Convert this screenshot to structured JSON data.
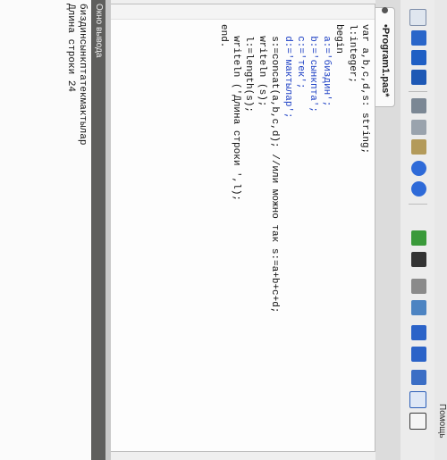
{
  "menu": {
    "help_label": "Помощь"
  },
  "tab": {
    "label": "•Program1.pas*"
  },
  "code_lines": [
    "var a,b,c,d,s: string;",
    "l:integer;",
    "begin",
    "  a:='биздин';",
    "  b:='сынкпта';",
    "  c:='тек';",
    "  d:='мактылар';",
    "  s:=concat(a,b,c,d); //или можно так s:=a+b+c+d;",
    "  writeln (s);",
    "  l:=length(s);",
    "  writeln ('Длина строки ',l);",
    "end."
  ],
  "output_panel": {
    "title": "Окно вывода",
    "lines": [
      "биздинсынкптатекмактылар",
      "Длина строки 24"
    ]
  },
  "toolbar_icons": [
    "new-file-icon",
    "open-icon",
    "save-icon",
    "save-all-icon",
    "cut-icon",
    "copy-icon",
    "paste-icon",
    "undo-icon",
    "redo-icon",
    "run-icon",
    "stop-icon",
    "compile-icon",
    "debug-step-icon",
    "step-into-icon",
    "step-over-icon",
    "layout-icon",
    "output-window-icon"
  ]
}
